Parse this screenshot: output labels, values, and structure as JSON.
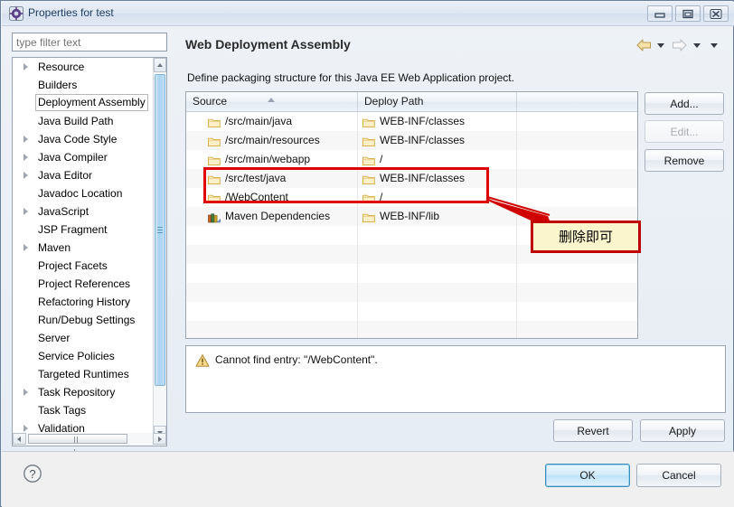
{
  "window": {
    "title": "Properties for test",
    "icon": "properties-icon",
    "controls": {
      "minimize": "minimize-icon",
      "maximize": "maximize-icon",
      "close": "close-icon"
    }
  },
  "sidebar": {
    "filter": {
      "placeholder": "type filter text",
      "value": ""
    },
    "items": [
      {
        "label": "Resource",
        "expandable": true,
        "selected": false
      },
      {
        "label": "Builders",
        "expandable": false,
        "selected": false
      },
      {
        "label": "Deployment Assembly",
        "expandable": false,
        "selected": true
      },
      {
        "label": "Java Build Path",
        "expandable": false,
        "selected": false
      },
      {
        "label": "Java Code Style",
        "expandable": true,
        "selected": false
      },
      {
        "label": "Java Compiler",
        "expandable": true,
        "selected": false
      },
      {
        "label": "Java Editor",
        "expandable": true,
        "selected": false
      },
      {
        "label": "Javadoc Location",
        "expandable": false,
        "selected": false
      },
      {
        "label": "JavaScript",
        "expandable": true,
        "selected": false
      },
      {
        "label": "JSP Fragment",
        "expandable": false,
        "selected": false
      },
      {
        "label": "Maven",
        "expandable": true,
        "selected": false
      },
      {
        "label": "Project Facets",
        "expandable": false,
        "selected": false
      },
      {
        "label": "Project References",
        "expandable": false,
        "selected": false
      },
      {
        "label": "Refactoring History",
        "expandable": false,
        "selected": false
      },
      {
        "label": "Run/Debug Settings",
        "expandable": false,
        "selected": false
      },
      {
        "label": "Server",
        "expandable": false,
        "selected": false
      },
      {
        "label": "Service Policies",
        "expandable": false,
        "selected": false
      },
      {
        "label": "Targeted Runtimes",
        "expandable": false,
        "selected": false
      },
      {
        "label": "Task Repository",
        "expandable": true,
        "selected": false
      },
      {
        "label": "Task Tags",
        "expandable": false,
        "selected": false
      },
      {
        "label": "Validation",
        "expandable": true,
        "selected": false
      }
    ]
  },
  "page": {
    "title": "Web Deployment Assembly",
    "description": "Define packaging structure for this Java EE Web Application project.",
    "nav": {
      "back_icon": "back-arrow-icon",
      "back_dropdown_icon": "chevron-down-icon",
      "forward_icon": "forward-arrow-icon",
      "forward_dropdown_icon": "chevron-down-icon",
      "menu_icon": "chevron-down-icon"
    }
  },
  "table": {
    "columns": [
      "Source",
      "Deploy Path",
      ""
    ],
    "sort_column": "Source",
    "sort_direction": "ascending",
    "rows": [
      {
        "source": "/src/main/java",
        "deploy": "WEB-INF/classes",
        "source_icon": "folder-icon",
        "deploy_icon": "folder-icon",
        "highlighted": false
      },
      {
        "source": "/src/main/resources",
        "deploy": "WEB-INF/classes",
        "source_icon": "folder-icon",
        "deploy_icon": "folder-icon",
        "highlighted": false
      },
      {
        "source": "/src/main/webapp",
        "deploy": "/",
        "source_icon": "folder-icon",
        "deploy_icon": "folder-icon",
        "highlighted": false
      },
      {
        "source": "/src/test/java",
        "deploy": "WEB-INF/classes",
        "source_icon": "folder-icon",
        "deploy_icon": "folder-icon",
        "highlighted": true
      },
      {
        "source": "/WebContent",
        "deploy": "/",
        "source_icon": "folder-icon",
        "deploy_icon": "folder-icon",
        "highlighted": true
      },
      {
        "source": "Maven Dependencies",
        "deploy": "WEB-INF/lib",
        "source_icon": "library-icon",
        "deploy_icon": "folder-icon",
        "highlighted": false
      }
    ]
  },
  "side_buttons": [
    {
      "label": "Add...",
      "enabled": true,
      "name": "add-button"
    },
    {
      "label": "Edit...",
      "enabled": false,
      "name": "edit-button"
    },
    {
      "label": "Remove",
      "enabled": true,
      "name": "remove-button"
    }
  ],
  "message": {
    "icon": "warning-icon",
    "text": "Cannot find entry: \"/WebContent\"."
  },
  "annotation": {
    "text": "删除即可",
    "box_color": "#c00000",
    "fill_color": "#fbf5cd",
    "highlight_color": "#e00000"
  },
  "footer": {
    "help_icon": "help-icon",
    "revert_label": "Revert",
    "apply_label": "Apply",
    "ok_label": "OK",
    "cancel_label": "Cancel"
  }
}
